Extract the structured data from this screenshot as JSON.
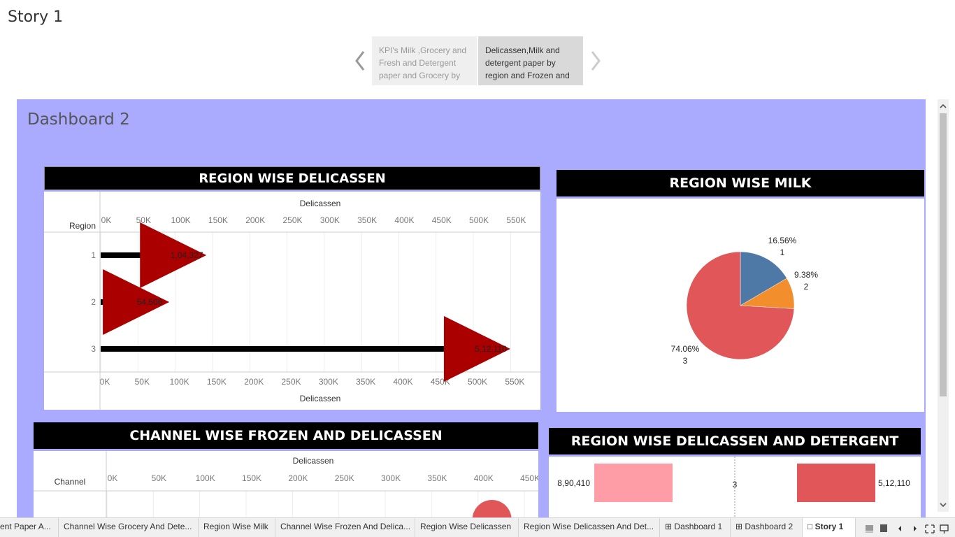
{
  "story": {
    "title": "Story 1",
    "points": [
      "KPI's Milk ,Grocery and Fresh and Detergent paper and Grocery by",
      "Delicassen,Milk and detergent paper by region and Frozen and"
    ]
  },
  "dashboard": {
    "title": "Dashboard 2",
    "bg_color": "#aaaaff"
  },
  "tabs": [
    "ent Paper A...",
    "Channel Wise Grocery And Dete...",
    "Region Wise Milk",
    "Channel Wise Frozen And Delica...",
    "Region Wise Delicassen",
    "Region Wise Delicassen And Det...",
    "Dashboard 1",
    "Dashboard 2",
    "Story 1"
  ],
  "chart_data": [
    {
      "type": "bar",
      "title": "REGION WISE DELICASSEN",
      "xlabel": "Delicassen",
      "ylabel": "Region",
      "categories": [
        "1",
        "2",
        "3"
      ],
      "values": [
        104327,
        54506,
        512110
      ],
      "labels": [
        "1,04,327",
        "54,506",
        "5,12,110"
      ],
      "xlim": [
        0,
        590000
      ],
      "ticks": [
        "0K",
        "50K",
        "100K",
        "150K",
        "200K",
        "250K",
        "300K",
        "350K",
        "400K",
        "450K",
        "500K",
        "550K"
      ],
      "color": "#000000",
      "marker_color": "#aa0000"
    },
    {
      "type": "pie",
      "title": "REGION WISE MILK",
      "slices": [
        {
          "label": "1",
          "value": 16.56,
          "text": "16.56%",
          "color": "#4e79a7"
        },
        {
          "label": "2",
          "value": 9.38,
          "text": "9.38%",
          "color": "#f28e2b"
        },
        {
          "label": "3",
          "value": 74.06,
          "text": "74.06%",
          "color": "#e15759"
        }
      ]
    },
    {
      "type": "bar",
      "title": "CHANNEL WISE FROZEN AND DELICASSEN",
      "xlabel": "Delicassen",
      "ylabel": "Channel",
      "ticks": [
        "0K",
        "50K",
        "100K",
        "150K",
        "200K",
        "250K",
        "300K",
        "350K",
        "400K",
        "450K"
      ],
      "xlim": [
        0,
        465000
      ],
      "marker_value": 415000,
      "marker_color": "#e15759"
    },
    {
      "type": "bar",
      "title": "REGION WISE DELICASSEN AND DETERGENT PAPER",
      "category": "3",
      "left_label": "8,90,410",
      "right_label": "5,12,110",
      "left_value": 890410,
      "right_value": 512110,
      "left_color": "#ff9da7",
      "right_color": "#e15759"
    }
  ]
}
